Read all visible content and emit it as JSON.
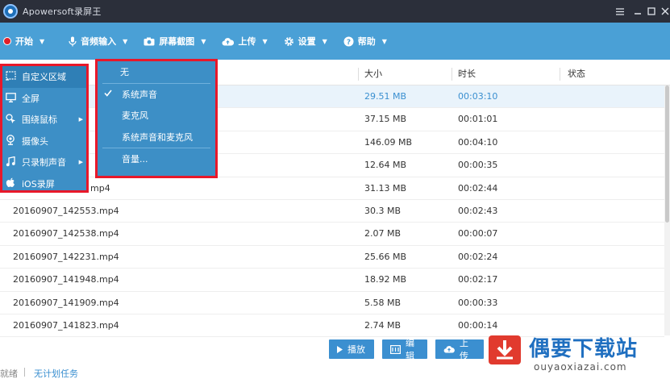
{
  "window": {
    "title": "Apowersoft录屏王",
    "controls": [
      "list-icon",
      "minimize-icon",
      "maximize-icon",
      "close-icon"
    ]
  },
  "toolbar": {
    "start": "开始",
    "audio_input": "音频输入",
    "screenshot": "屏幕截图",
    "upload": "上传",
    "settings": "设置",
    "help": "帮助"
  },
  "table": {
    "headers": {
      "name": "",
      "size": "大小",
      "time": "时长",
      "status": "状态"
    },
    "rows": [
      {
        "name": "",
        "size": "29.51 MB",
        "time": "00:03:10"
      },
      {
        "name": "",
        "size": "37.15 MB",
        "time": "00:01:01"
      },
      {
        "name": "",
        "size": "146.09 MB",
        "time": "00:04:10"
      },
      {
        "name": "",
        "size": "12.64 MB",
        "time": "00:00:35"
      },
      {
        "name": "mp4",
        "size": "31.13 MB",
        "time": "00:02:44"
      },
      {
        "name": "20160907_142553.mp4",
        "size": "30.3 MB",
        "time": "00:02:43"
      },
      {
        "name": "20160907_142538.mp4",
        "size": "2.07 MB",
        "time": "00:00:07"
      },
      {
        "name": "20160907_142231.mp4",
        "size": "25.66 MB",
        "time": "00:02:24"
      },
      {
        "name": "20160907_141948.mp4",
        "size": "18.92 MB",
        "time": "00:02:17"
      },
      {
        "name": "20160907_141909.mp4",
        "size": "5.58 MB",
        "time": "00:00:33"
      },
      {
        "name": "20160907_141823.mp4",
        "size": "2.74 MB",
        "time": "00:00:14"
      }
    ]
  },
  "record_menu": {
    "items": [
      {
        "label": "自定义区域",
        "icon": "region-icon"
      },
      {
        "label": "全屏",
        "icon": "monitor-icon"
      },
      {
        "label": "围绕鼠标",
        "icon": "cursor-icon"
      },
      {
        "label": "摄像头",
        "icon": "webcam-icon"
      },
      {
        "label": "只录制声音",
        "icon": "music-icon"
      },
      {
        "label": "iOS录屏",
        "icon": "apple-icon"
      }
    ]
  },
  "audio_menu": {
    "items": [
      {
        "label": "无",
        "checked": false
      },
      {
        "label": "系统声音",
        "checked": true
      },
      {
        "label": "麦克风",
        "checked": false
      },
      {
        "label": "系统声音和麦克风",
        "checked": false
      },
      {
        "label": "音量...",
        "checked": false
      }
    ]
  },
  "buttons": {
    "play": "播放",
    "edit": "编辑",
    "upload": "上传"
  },
  "status": {
    "state": "就绪",
    "schedule": "无计划任务"
  },
  "watermark": {
    "title": "偶要下载站",
    "url": "ouyaoxiazai.com"
  },
  "colors": {
    "toolbar": "#4aa0d6",
    "titlebar": "#2b2f3a",
    "menu": "#3d8fc6",
    "highlight_border": "#e8182a",
    "accent": "#3a8fd0"
  }
}
